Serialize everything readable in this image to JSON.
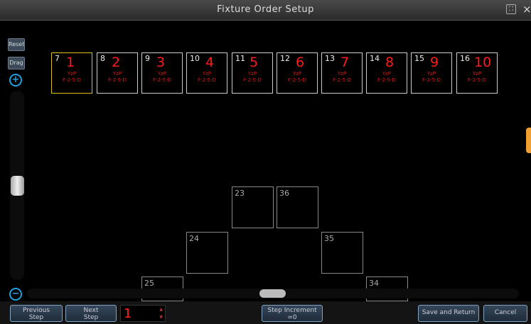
{
  "window": {
    "title": "Fixture Order Setup"
  },
  "side": {
    "reset_label": "Reset",
    "drag_label": "Drag"
  },
  "fixtures": [
    {
      "id": "7",
      "order": "1",
      "line1": "YzP",
      "line2": "F-2-5-D",
      "selected": true
    },
    {
      "id": "8",
      "order": "2",
      "line1": "YzP",
      "line2": "F-2-5-D"
    },
    {
      "id": "9",
      "order": "3",
      "line1": "YzP",
      "line2": "F-2-5-D"
    },
    {
      "id": "10",
      "order": "4",
      "line1": "YzP",
      "line2": "F-2-5-D"
    },
    {
      "id": "11",
      "order": "5",
      "line1": "YzP",
      "line2": "F-2-5-D"
    },
    {
      "id": "12",
      "order": "6",
      "line1": "YzP",
      "line2": "F-2-5-D"
    },
    {
      "id": "13",
      "order": "7",
      "line1": "YzP",
      "line2": "F-2-5-D"
    },
    {
      "id": "14",
      "order": "8",
      "line1": "YzP",
      "line2": "F-2-5-D"
    },
    {
      "id": "15",
      "order": "9",
      "line1": "YzP",
      "line2": "F-2-5-D"
    },
    {
      "id": "16",
      "order": "10",
      "line1": "YzP",
      "line2": "F-2-5-D"
    }
  ],
  "grid_boxes": [
    "23",
    "36",
    "24",
    "35",
    "25",
    "34"
  ],
  "bottom": {
    "previous_step_line1": "Previous",
    "previous_step_line2": "Step",
    "next_step_line1": "Next",
    "next_step_line2": "Step",
    "step_value": "1",
    "step_increment_line1": "Step Increment",
    "step_increment_line2": "=0",
    "save_return_label": "Save and Return",
    "cancel_label": "Cancel"
  },
  "colors": {
    "order_number": "#ff1a1a",
    "selected_border": "#d8c21a",
    "accent": "#1ea0e0",
    "handle": "#f0a030"
  }
}
